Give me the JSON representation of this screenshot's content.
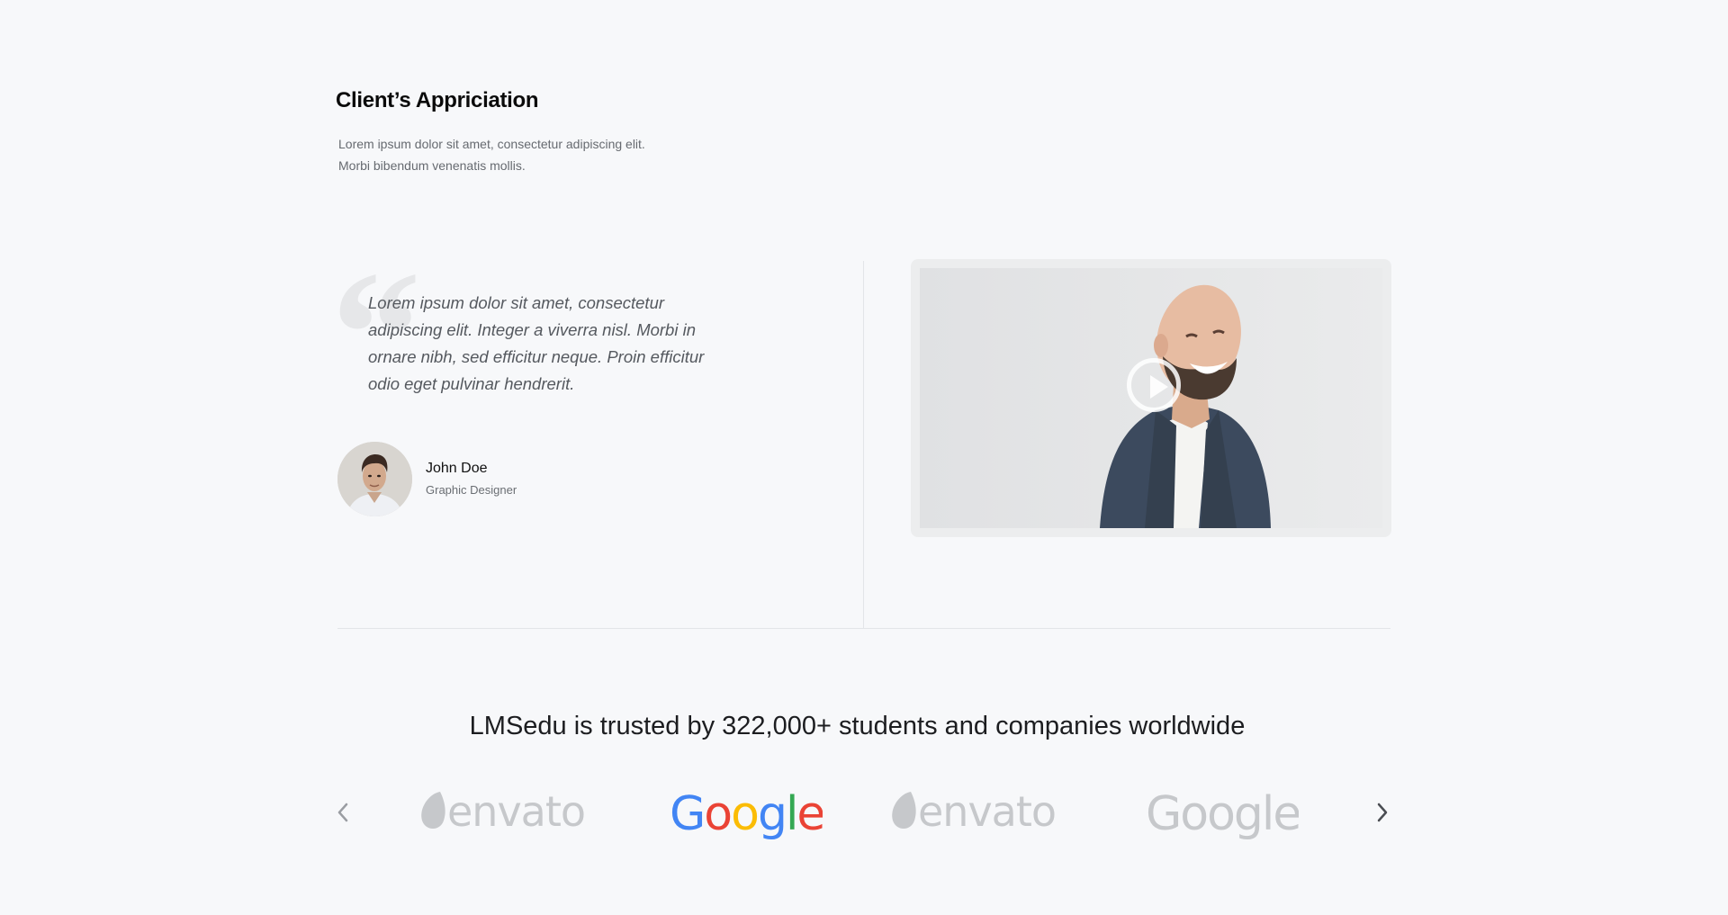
{
  "section": {
    "title": "Client’s Appriciation",
    "description_lines": [
      "Lorem ipsum dolor sit amet, consectetur adipiscing elit.",
      "Morbi bibendum venenatis mollis."
    ]
  },
  "testimonial": {
    "quote_mark": "“",
    "quote": "Lorem ipsum dolor sit amet, consectetur adipiscing elit. Integer a viverra nisl. Morbi in ornare nibh, sed efficitur neque. Proin efficitur odio eget pulvinar hendrerit.",
    "author_name": "John Doe",
    "author_role": "Graphic Designer"
  },
  "video": {
    "play_icon": "play-circle-icon"
  },
  "trusted": {
    "title": "LMSedu is trusted by 322,000+ students and companies worldwide",
    "prev_icon": "chevron-left-icon",
    "next_icon": "chevron-right-icon",
    "logos": [
      {
        "name": "envato",
        "style": "grey"
      },
      {
        "name": "Google",
        "style": "color"
      },
      {
        "name": "envato",
        "style": "grey"
      },
      {
        "name": "Google",
        "style": "grey"
      }
    ]
  },
  "colors": {
    "background": "#f7f8fa",
    "logo_grey": "#c6c8cb",
    "google_blue": "#4285f4",
    "google_red": "#ea4335",
    "google_yellow": "#fbbc05",
    "google_green": "#34a853"
  }
}
